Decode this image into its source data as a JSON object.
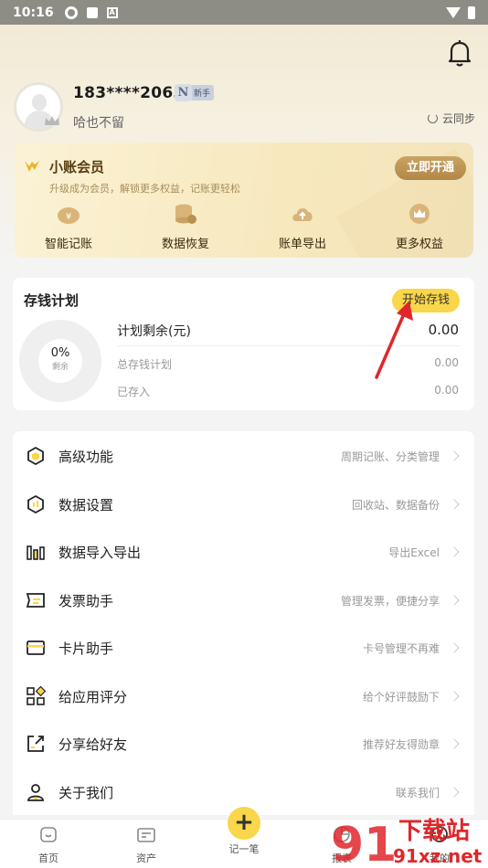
{
  "status_bar": {
    "time": "10:16"
  },
  "profile": {
    "phone": "183****2063",
    "level_letter": "N",
    "level_tag": "新手",
    "bio": "哈也不留",
    "cloud_sync": "云同步"
  },
  "vip": {
    "title": "小账会员",
    "subtitle": "升级成为会员，解锁更多权益，记账更轻松",
    "button": "立即开通",
    "features": [
      {
        "label": "智能记账",
        "icon": "smart-bookkeeping-icon"
      },
      {
        "label": "数据恢复",
        "icon": "data-restore-icon"
      },
      {
        "label": "账单导出",
        "icon": "bill-export-icon"
      },
      {
        "label": "更多权益",
        "icon": "crown-icon"
      }
    ]
  },
  "savings": {
    "title": "存钱计划",
    "button": "开始存钱",
    "progress_percent": 0,
    "progress_text": "0%",
    "progress_label": "剩余",
    "remaining_label": "计划剩余(元)",
    "remaining_value": "0.00",
    "total_label": "总存钱计划",
    "total_value": "0.00",
    "saved_label": "已存入",
    "saved_value": "0.00"
  },
  "menu": [
    {
      "label": "高级功能",
      "hint": "周期记账、分类管理",
      "icon": "hexagon-icon"
    },
    {
      "label": "数据设置",
      "hint": "回收站、数据备份",
      "icon": "data-settings-icon"
    },
    {
      "label": "数据导入导出",
      "hint": "导出Excel",
      "icon": "bar-chart-icon"
    },
    {
      "label": "发票助手",
      "hint": "管理发票，便捷分享",
      "icon": "invoice-icon"
    },
    {
      "label": "卡片助手",
      "hint": "卡号管理不再难",
      "icon": "card-icon"
    },
    {
      "label": "给应用评分",
      "hint": "给个好评鼓励下",
      "icon": "grid-icon"
    },
    {
      "label": "分享给好友",
      "hint": "推荐好友得勋章",
      "icon": "share-icon"
    },
    {
      "label": "关于我们",
      "hint": "联系我们",
      "icon": "person-icon"
    }
  ],
  "tabs": [
    {
      "label": "首页",
      "icon": "home-icon"
    },
    {
      "label": "资产",
      "icon": "wallet-icon"
    },
    {
      "label": "记一笔",
      "icon": "plus-icon"
    },
    {
      "label": "报表",
      "icon": "report-icon"
    },
    {
      "label": "我的",
      "icon": "profile-icon"
    }
  ],
  "watermark": {
    "line1": "下载站",
    "line2": "91xz.net",
    "number": "91"
  },
  "colors": {
    "accent_yellow": "#f9d64a",
    "vip_gold": "#b18746",
    "arrow_red": "#e0262b"
  }
}
